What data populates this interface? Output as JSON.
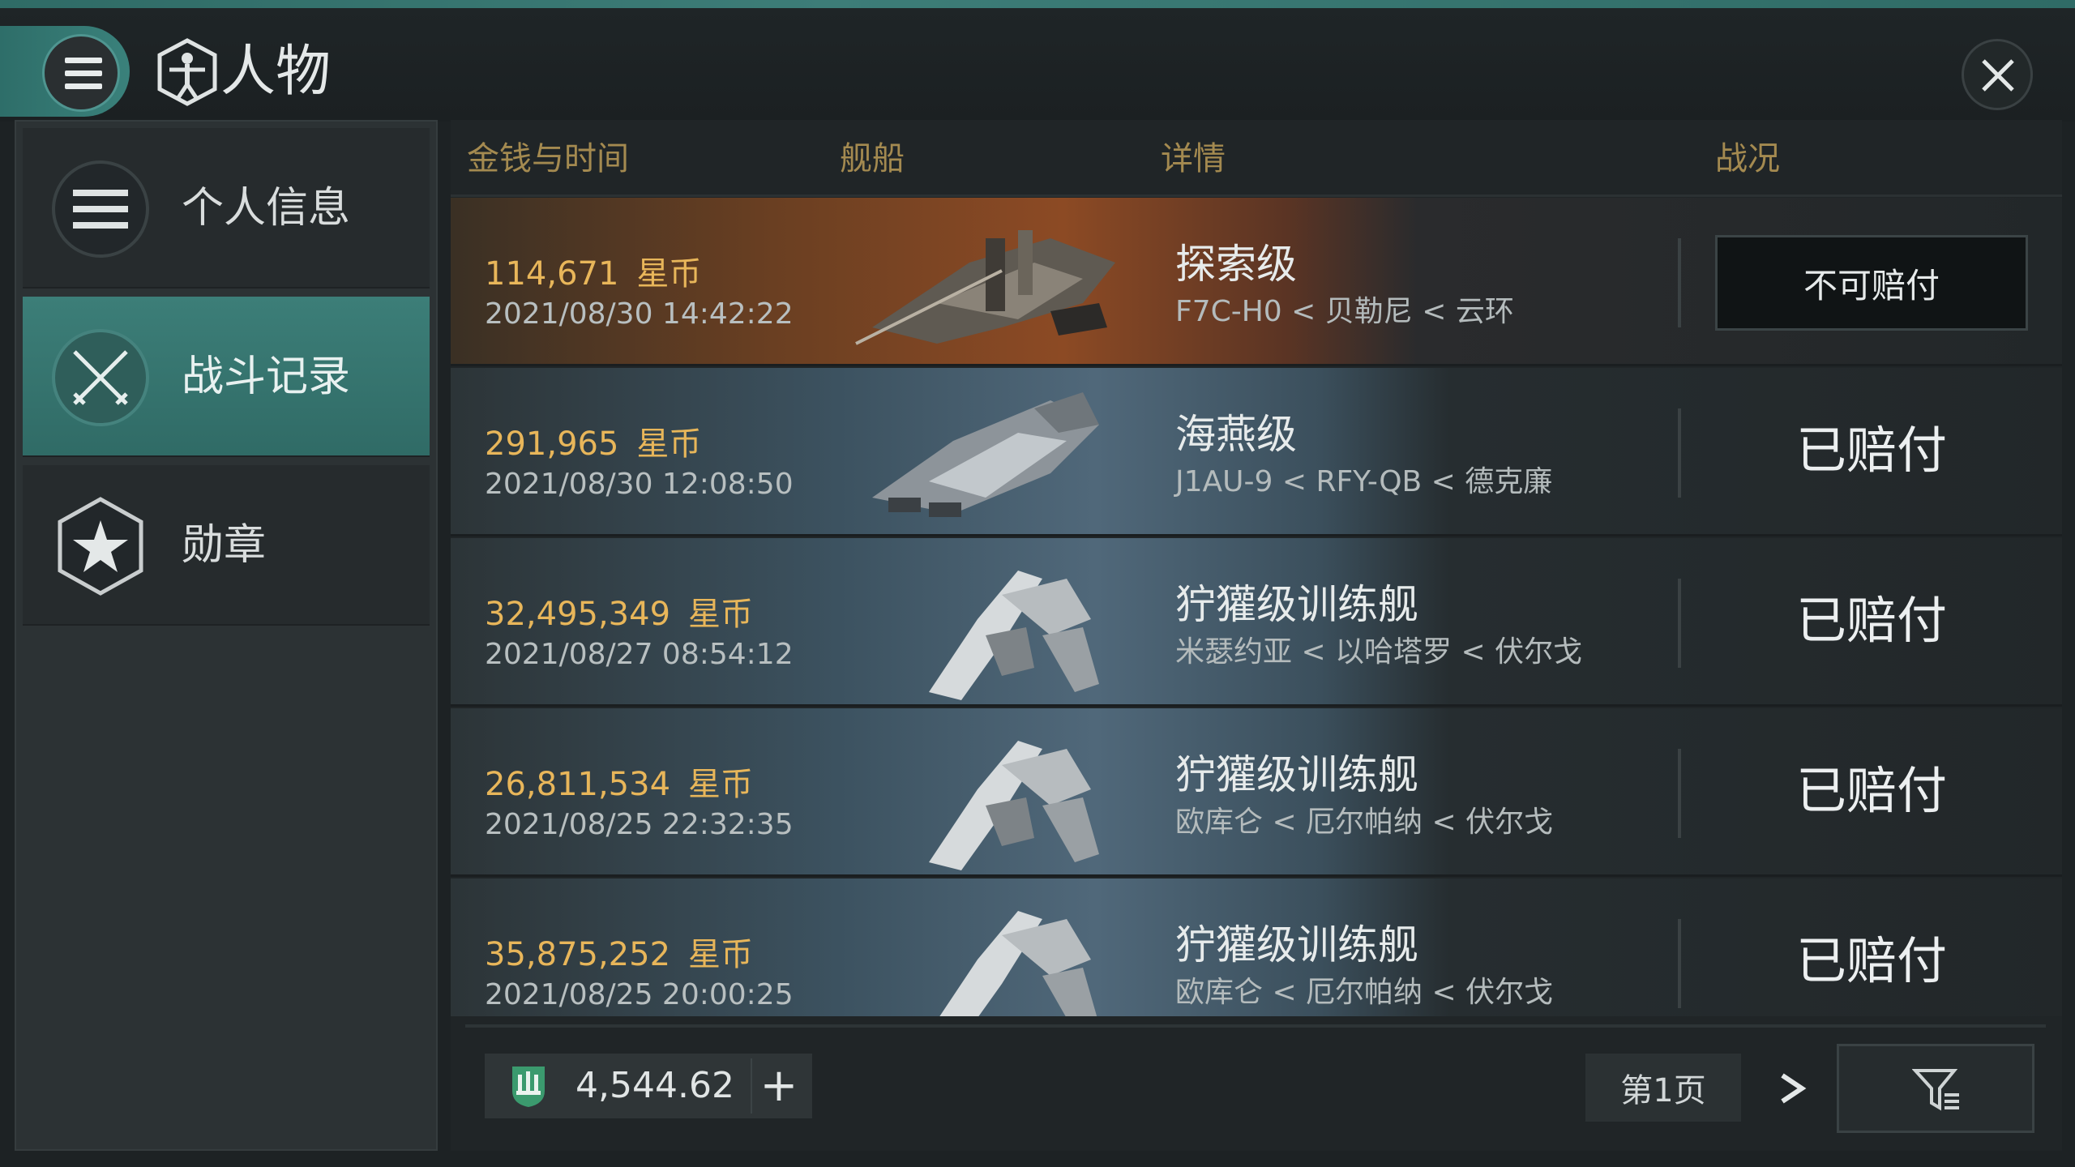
{
  "header": {
    "title": "人物",
    "menu_icon": "hamburger-menu-icon",
    "title_icon": "character-icon",
    "close_icon": "close-icon"
  },
  "sidebar": {
    "items": [
      {
        "label": "个人信息",
        "icon": "list-icon",
        "active": false
      },
      {
        "label": "战斗记录",
        "icon": "crossed-swords-icon",
        "active": true
      },
      {
        "label": "勋章",
        "icon": "star-medal-icon",
        "active": false
      }
    ]
  },
  "table": {
    "columns": [
      "金钱与时间",
      "舰船",
      "详情",
      "战况"
    ],
    "rows": [
      {
        "amount": "114,671",
        "unit": "星币",
        "datetime": "2021/08/30  14:42:22",
        "ship_name": "探索级",
        "route": "F7C-H0 < 贝勒尼 < 云环",
        "status": "不可赔付",
        "status_boxed": true,
        "theme": "orange"
      },
      {
        "amount": "291,965",
        "unit": "星币",
        "datetime": "2021/08/30  12:08:50",
        "ship_name": "海燕级",
        "route": "J1AU-9 < RFY-QB < 德克廉",
        "status": "已赔付",
        "status_boxed": false,
        "theme": "blue"
      },
      {
        "amount": "32,495,349",
        "unit": "星币",
        "datetime": "2021/08/27  08:54:12",
        "ship_name": "狞獾级训练舰",
        "route": "米瑟约亚 < 以哈塔罗 < 伏尔戈",
        "status": "已赔付",
        "status_boxed": false,
        "theme": "blue"
      },
      {
        "amount": "26,811,534",
        "unit": "星币",
        "datetime": "2021/08/25  22:32:35",
        "ship_name": "狞獾级训练舰",
        "route": "欧库仑 < 厄尔帕纳 < 伏尔戈",
        "status": "已赔付",
        "status_boxed": false,
        "theme": "blue"
      },
      {
        "amount": "35,875,252",
        "unit": "星币",
        "datetime": "2021/08/25  20:00:25",
        "ship_name": "狞獾级训练舰",
        "route": "欧库仑 < 厄尔帕纳 < 伏尔戈",
        "status": "已赔付",
        "status_boxed": false,
        "theme": "blue"
      }
    ]
  },
  "footer": {
    "wallet_value": "4,544.62",
    "wallet_add": "+",
    "wallet_icon": "wallet-currency-icon",
    "page_label": "第1页",
    "next_icon": "chevron-right-icon",
    "filter_icon": "filter-icon"
  },
  "colors": {
    "accent": "#3a817b",
    "gold": "#e8b65a",
    "column_header": "#a48a50"
  }
}
